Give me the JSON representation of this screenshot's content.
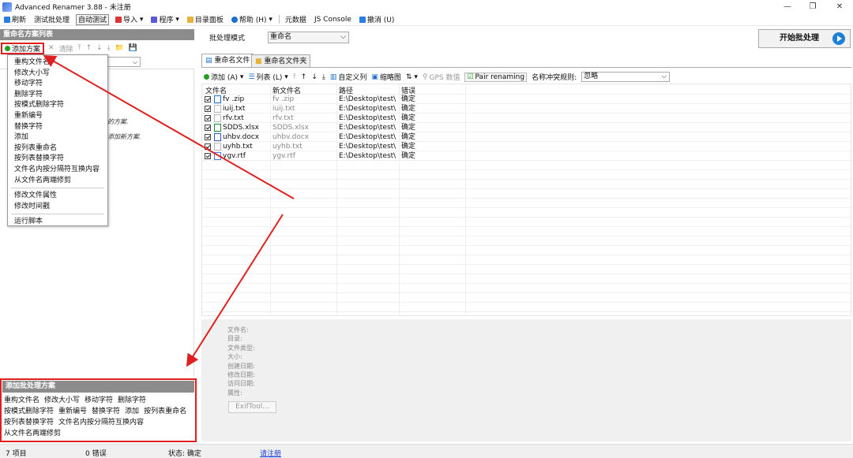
{
  "window": {
    "title": "Advanced Renamer 3.88 - 未注册",
    "minimize": "—",
    "maximize": "❐",
    "close": "✕"
  },
  "menubar": {
    "refresh": "刷新",
    "test_batch": "测试批处理",
    "auto_test": "自动测试",
    "import": "导入",
    "program": "程序",
    "dir_panel": "目录面板",
    "help": "帮助 (H)",
    "metadata": "元数据",
    "js_console": "JS Console",
    "undo": "撤消 (U)"
  },
  "left_panel": {
    "header": "重命名方案列表",
    "toolbar": {
      "add_method": "添加方案",
      "delete": "清除",
      "move_top": "⤒",
      "move_up": "↑",
      "move_down": "↓",
      "move_bottom": "⤓",
      "open": "📁",
      "save": "💾"
    },
    "hint_1": "的方案.",
    "hint_2": "添加新方案."
  },
  "dropdown": {
    "items_1": [
      "重构文件名",
      "修改大小写",
      "移动字符",
      "删除字符",
      "按模式删除字符",
      "重新编号",
      "替换字符",
      "添加",
      "按列表重命名",
      "按列表替换字符",
      "文件名内按分隔符互换内容",
      "从文件名两端修剪"
    ],
    "items_2": [
      "修改文件属性",
      "修改时间戳"
    ],
    "items_3": [
      "运行脚本"
    ]
  },
  "method_box": {
    "header": "添加批处理方案",
    "row1": [
      "重构文件名",
      "修改大小写",
      "移动字符",
      "删除字符"
    ],
    "row2": [
      "按模式删除字符",
      "重新编号",
      "替换字符",
      "添加",
      "按列表重命名"
    ],
    "row3": [
      "按列表替换字符",
      "文件名内按分隔符互换内容"
    ],
    "row4": [
      "从文件名两端修剪"
    ]
  },
  "right_panel": {
    "mode_label": "批处理模式",
    "mode_value": "重命名",
    "start_button": "开始批处理",
    "tabs": [
      "重命名文件",
      "重命名文件夹"
    ],
    "file_toolbar": {
      "add": "添加 (A)",
      "list": "列表 (L)",
      "custom_columns": "自定义列",
      "thumbnails": "缩略图",
      "gps": "GPS 数值",
      "pair_renaming": "Pair renaming",
      "conflict_label": "名称冲突规则:",
      "conflict_value": "忽略"
    },
    "columns": [
      "文件名",
      "新文件名",
      "路径",
      "错误"
    ],
    "files": [
      {
        "name": "fv .zip",
        "new_name": "fv .zip",
        "path": "E:\\Desktop\\test\\",
        "error": "确定"
      },
      {
        "name": "iuij.txt",
        "new_name": "iuij.txt",
        "path": "E:\\Desktop\\test\\",
        "error": "确定"
      },
      {
        "name": "rfv.txt",
        "new_name": "rfv.txt",
        "path": "E:\\Desktop\\test\\",
        "error": "确定"
      },
      {
        "name": "SDDS.xlsx",
        "new_name": "SDDS.xlsx",
        "path": "E:\\Desktop\\test\\",
        "error": "确定"
      },
      {
        "name": "uhbv.docx",
        "new_name": "uhbv.docx",
        "path": "E:\\Desktop\\test\\",
        "error": "确定"
      },
      {
        "name": "uyhb.txt",
        "new_name": "uyhb.txt",
        "path": "E:\\Desktop\\test\\",
        "error": "确定"
      },
      {
        "name": "ygv.rtf",
        "new_name": "ygv.rtf",
        "path": "E:\\Desktop\\test\\",
        "error": "确定"
      }
    ],
    "info_labels": [
      "文件名:",
      "目录:",
      "文件类型:",
      "大小:",
      "创建日期:",
      "修改日期:",
      "访问日期:",
      "属性:"
    ],
    "exif_button": "ExifTool..."
  },
  "statusbar": {
    "items": "7 项目",
    "errors": "0 错误",
    "status": "状态: 确定",
    "register": "请注册"
  },
  "colors": {
    "highlight": "#e02020",
    "header_gray": "#8c8c8c",
    "accent_blue": "#1e7fd6"
  }
}
